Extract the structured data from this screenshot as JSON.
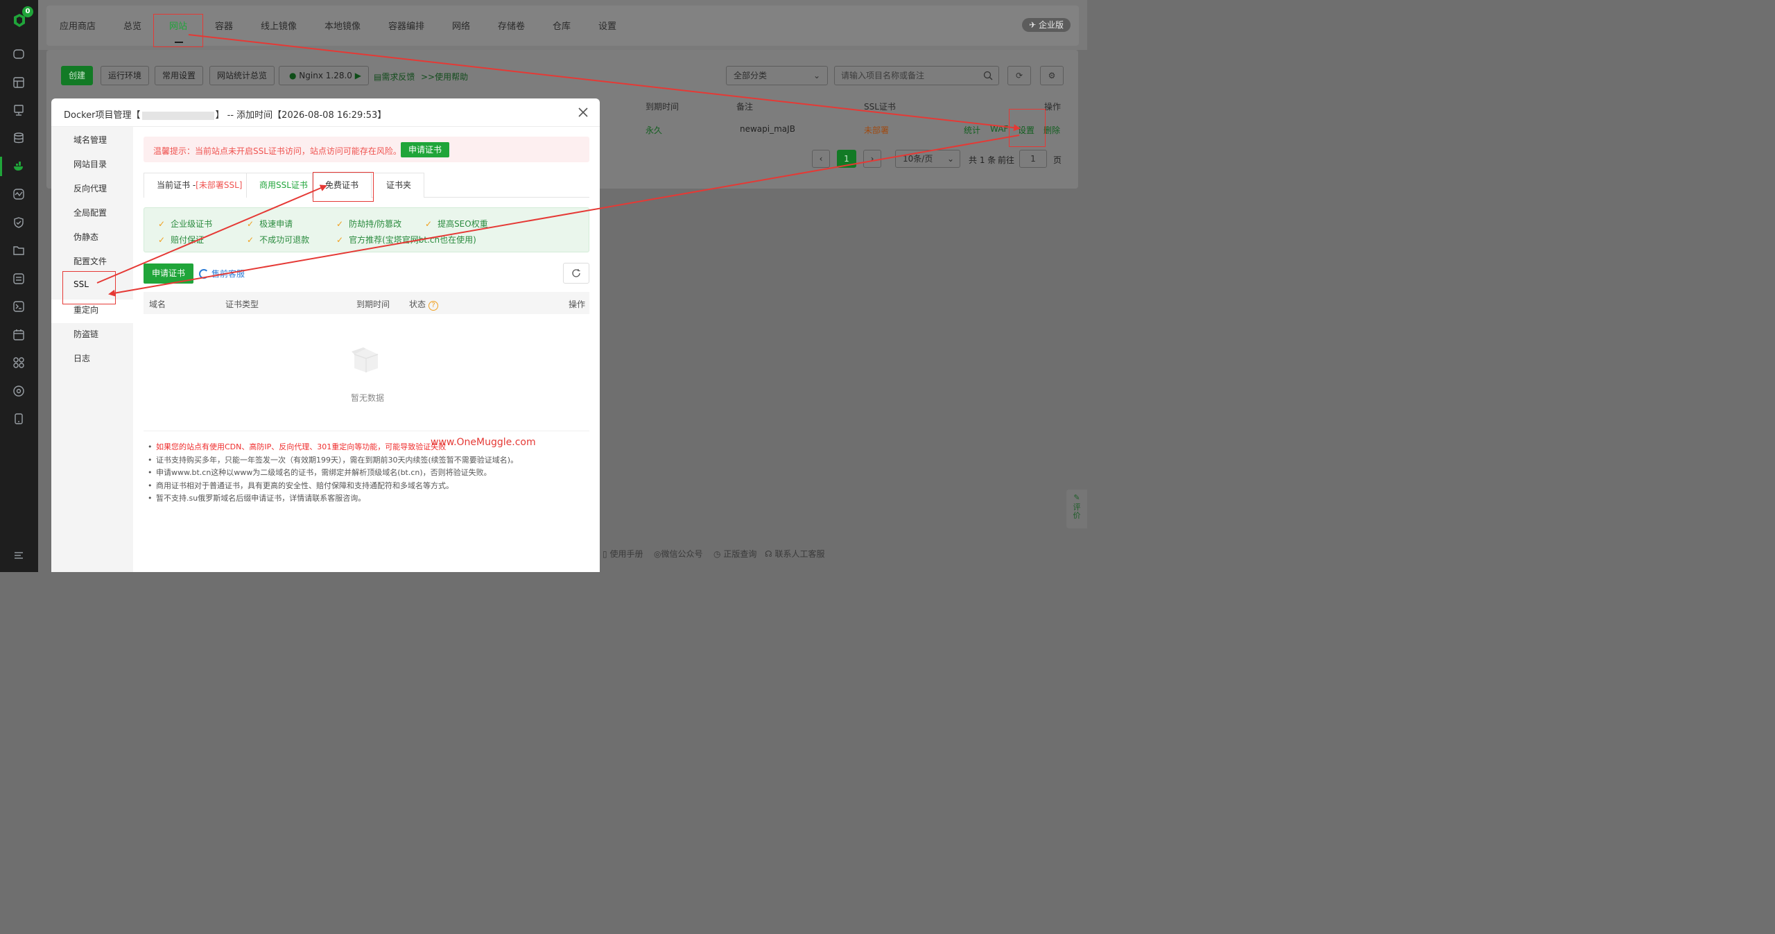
{
  "sidebar": {
    "badge": "0",
    "icons": [
      "home-icon",
      "layout-icon",
      "monitor-icon",
      "database-icon",
      "docker-icon",
      "activity-icon",
      "shield-icon",
      "folder-icon",
      "log-icon",
      "terminal-icon",
      "calendar-icon",
      "apps-icon",
      "settings-circle-icon",
      "mobile-icon",
      "menu-icon"
    ]
  },
  "topnav": {
    "tabs": [
      "应用商店",
      "总览",
      "网站",
      "容器",
      "线上镜像",
      "本地镜像",
      "容器编排",
      "网络",
      "存储卷",
      "仓库",
      "设置"
    ],
    "active": "网站",
    "enterprise": "企业版"
  },
  "toolbar": {
    "create": "创建",
    "runtime": "运行环境",
    "common_settings": "常用设置",
    "site_stats": "网站统计总览",
    "nginx": "Nginx 1.28.0",
    "feedback": "需求反馈",
    "help": ">>使用帮助",
    "category": "全部分类",
    "search_placeholder": "请输入项目名称或备注"
  },
  "table": {
    "headers": {
      "expire": "到期时间",
      "remark": "备注",
      "ssl": "SSL证书",
      "ops": "操作"
    },
    "row": {
      "expire": "永久",
      "remark": "newapi_maJB",
      "ssl": "未部署",
      "stats": "统计",
      "waf": "WAF",
      "settings": "设置",
      "delete": "删除"
    }
  },
  "pager": {
    "current": "1",
    "page_size": "10条/页",
    "total": "共 1 条",
    "goto": "前往",
    "goto_value": "1",
    "page_unit": "页"
  },
  "footer": {
    "manual": "使用手册",
    "wechat": "微信公众号",
    "verify": "正版查询",
    "service": "联系人工客服"
  },
  "review": "评价",
  "modal": {
    "title_prefix": "Docker项目管理【",
    "title_suffix": "】 -- 添加时间【2026-08-08 16:29:53】",
    "menu": [
      "域名管理",
      "网站目录",
      "反向代理",
      "全局配置",
      "伪静态",
      "配置文件",
      "SSL",
      "重定向",
      "防盗链",
      "日志"
    ],
    "warning": "温馨提示：当前站点未开启SSL证书访问，站点访问可能存在风险。",
    "warning_button": "申请证书",
    "tabs": {
      "current": "当前证书 -",
      "current_status": "[未部署SSL]",
      "commercial": "商用SSL证书",
      "free": "免费证书",
      "folder": "证书夹"
    },
    "features": [
      "企业级证书",
      "极速申请",
      "防劫持/防篡改",
      "提高SEO权重",
      "赔付保证",
      "不成功可退款",
      "官方推荐(宝塔官网bt.cn也在使用)"
    ],
    "apply_button": "申请证书",
    "presales": "售前客服",
    "columns": {
      "domain": "域名",
      "type": "证书类型",
      "expire": "到期时间",
      "status": "状态",
      "status_help": "?",
      "ops": "操作"
    },
    "empty": "暂无数据",
    "notes": [
      "如果您的站点有使用CDN、高防IP、反向代理、301重定向等功能，可能导致验证失败",
      "证书支持购买多年，只能一年签发一次（有效期199天），需在到期前30天内续签(续签暂不需要验证域名)。",
      "申请www.bt.cn这种以www为二级域名的证书，需绑定并解析顶级域名(bt.cn)，否则将验证失败。",
      "商用证书相对于普通证书，具有更高的安全性、赔付保障和支持通配符和多域名等方式。",
      "暂不支持.su俄罗斯域名后缀申请证书，详情请联系客服咨询。"
    ]
  },
  "watermark": "www.OneMuggle.com",
  "colors": {
    "brand": "#20a53a",
    "warning": "#ef5350",
    "annotation": "#e53935"
  }
}
